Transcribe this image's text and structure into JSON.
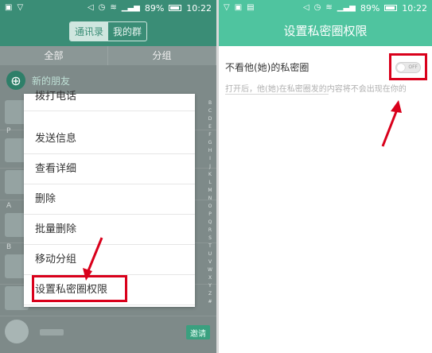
{
  "status": {
    "left_battery": "89%",
    "left_time": "10:22",
    "right_battery": "89%",
    "right_time": "10:22"
  },
  "contacts": {
    "tabs": [
      "通讯录",
      "我的群"
    ],
    "groups": [
      "全部",
      "分组"
    ],
    "new_friends": "新的朋友",
    "invite": "邀请",
    "index_letters": [
      "B",
      "C",
      "D",
      "E",
      "F",
      "G",
      "H",
      "I",
      "J",
      "K",
      "L",
      "M",
      "N",
      "O",
      "P",
      "Q",
      "R",
      "S",
      "T",
      "U",
      "V",
      "W",
      "X",
      "Y",
      "Z",
      "#"
    ],
    "section_letters": [
      "P",
      "A",
      "B"
    ]
  },
  "menu": {
    "items": [
      "拨打电话",
      "发送信息",
      "查看详细",
      "删除",
      "批量删除",
      "移动分组",
      "设置私密圈权限"
    ]
  },
  "privacy": {
    "title": "设置私密圈权限",
    "setting_label": "不看他(她)的私密圈",
    "toggle_state": "OFF",
    "description": "打开后，他(她)在私密圈发的内容将不会出现在你的"
  },
  "colors": {
    "accent_left": "#3a8d76",
    "accent_right": "#4fc49f",
    "highlight": "#d9001b"
  }
}
